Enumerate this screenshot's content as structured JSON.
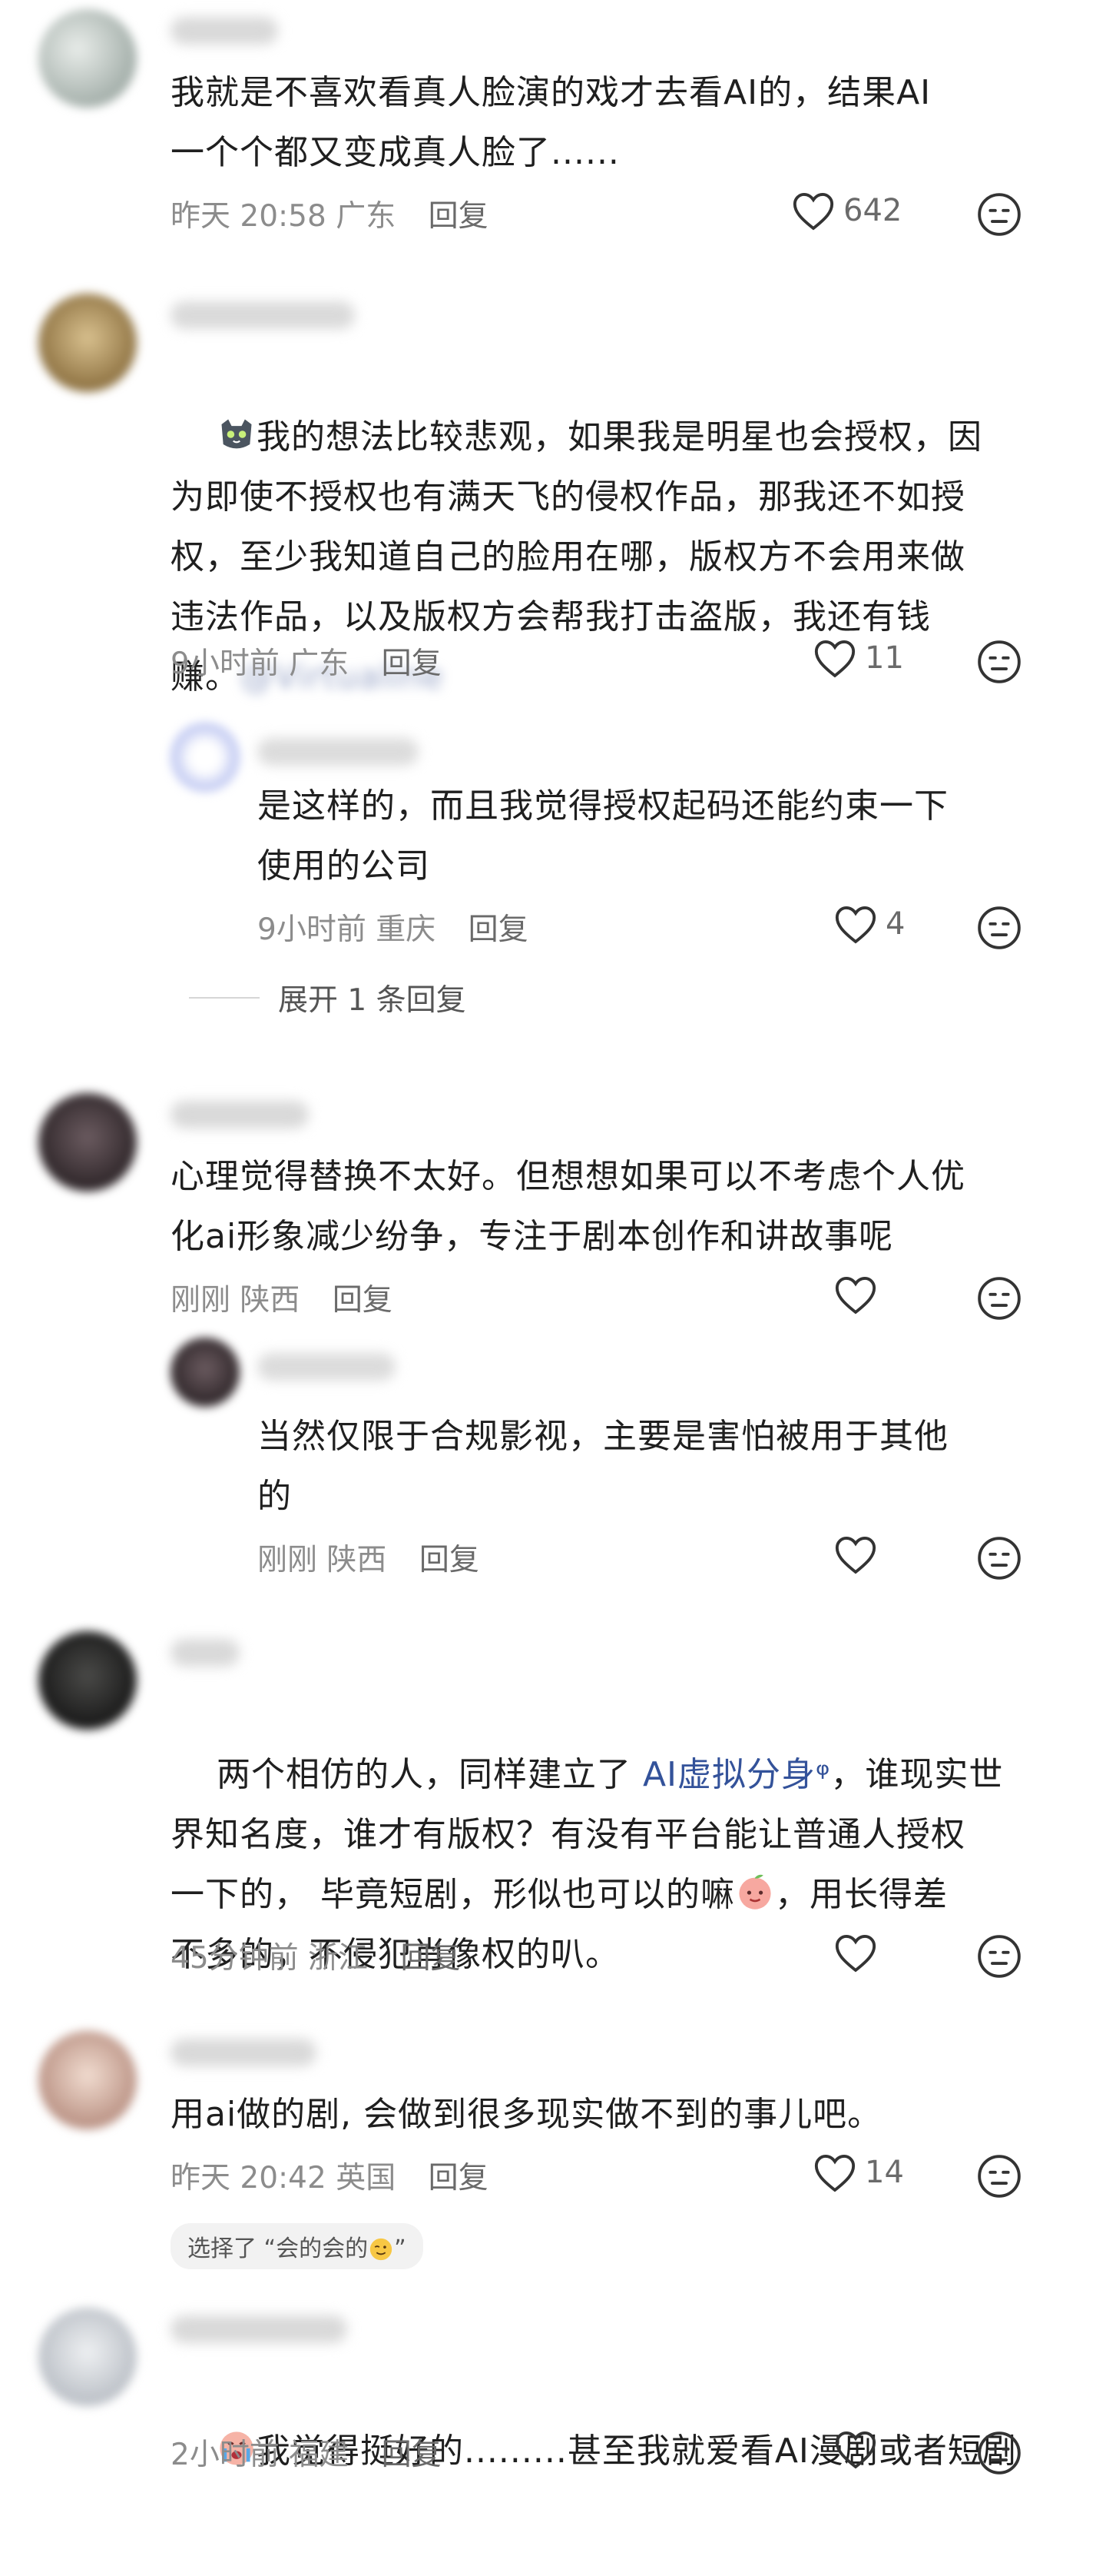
{
  "comments": [
    {
      "text": "我就是不喜欢看真人脸演的戏才去看AI的，结果AI\n一个个都又变成真人脸了......",
      "time": "昨天 20:58",
      "location": "广东",
      "reply": "回复",
      "likes": "642"
    },
    {
      "text_pre": "我的想法比较悲观，如果我是明星也会授权，因\n为即使不授权也有满天飞的侵权作品，那我还不如授\n权，至少我知道自己的脸用在哪，版权方不会用来做\n违法作品，以及版权方会帮我打击盗版，我还有钱\n赚。",
      "time": "9小时前",
      "location": "广东",
      "reply": "回复",
      "likes": "11",
      "subreply": {
        "text": "是这样的，而且我觉得授权起码还能约束一下\n使用的公司",
        "time": "9小时前",
        "location": "重庆",
        "reply": "回复",
        "likes": "4"
      },
      "expand": "展开 1 条回复"
    },
    {
      "text": "心理觉得替换不太好。但想想如果可以不考虑个人优\n化ai形象减少纷争，专注于剧本创作和讲故事呢",
      "time": "刚刚",
      "location": "陕西",
      "reply": "回复",
      "subreply": {
        "text": "当然仅限于合规影视，主要是害怕被用于其他\n的",
        "time": "刚刚",
        "location": "陕西",
        "reply": "回复"
      }
    },
    {
      "text_a": "两个相仿的人，同样建立了 ",
      "link": "AI虚拟分身",
      "link_icon": "ᵠ",
      "text_b": "，谁现实世\n界知名度，谁才有版权？有没有平台能让普通人授权\n一下的， 毕竟短剧，形似也可以的嘛",
      "text_c": "，用长得差\n不多的，不侵犯肖像权的叭。",
      "time": "45分钟前",
      "location": "浙江",
      "reply": "回复"
    },
    {
      "text": "用ai做的剧, 会做到很多现实做不到的事儿吧。",
      "time": "昨天 20:42",
      "location": "英国",
      "reply": "回复",
      "likes": "14",
      "chip": "选择了 “会的会的",
      "chip_end": "”"
    },
    {
      "text": "我觉得挺好的.........甚至我就爱看AI漫剧或者短剧",
      "time": "2小时前",
      "location": "福建",
      "reply": "回复"
    }
  ],
  "icons": [
    "heart-icon",
    "face-emoji-icon",
    "cat-emoji-icon",
    "peach-emoji-icon",
    "crying-emoji-icon",
    "wink-emoji-icon"
  ]
}
